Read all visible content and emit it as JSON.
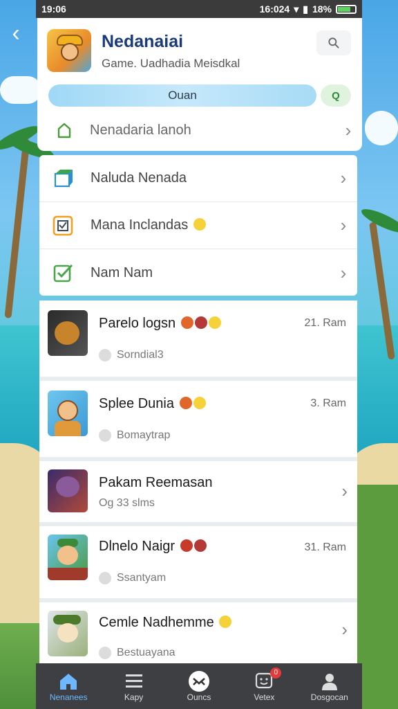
{
  "status_bar": {
    "time": "19:06",
    "right_text": "16:024",
    "battery": "18%"
  },
  "header": {
    "title": "Nedanaiai",
    "subtitle": "Game. Uadhadia Meisdkal",
    "pill_label": "Ouan",
    "pill_go_label": "Q",
    "row_label": "Nenadaria lanoh"
  },
  "menu": [
    {
      "label": "Naluda Nenada",
      "icon": "cube-icon"
    },
    {
      "label": "Mana Inclandas",
      "icon": "checklist-icon"
    },
    {
      "label": "Nam Nam",
      "icon": "check-square-icon"
    }
  ],
  "games": [
    {
      "name": "Parelo logsn",
      "sub": "Sorndial3",
      "time": "21. Ram"
    },
    {
      "name": "Splee Dunia",
      "sub": "Bomaytrap",
      "time": "3. Ram"
    },
    {
      "name": "Pakam Reemasan",
      "sub": "Og 33 slms",
      "time": ""
    },
    {
      "name": "Dlnelo Naigr",
      "sub": "Ssantyam",
      "time": "31. Ram"
    },
    {
      "name": "Cemle Nadhemme",
      "sub": "Bestuayana",
      "time": ""
    }
  ],
  "bottom_nav": [
    {
      "label": "Nenanees",
      "icon": "home-icon"
    },
    {
      "label": "Kapy",
      "icon": "list-icon"
    },
    {
      "label": "Ouncs",
      "icon": "gamepad-icon"
    },
    {
      "label": "Vetex",
      "icon": "chat-icon",
      "badge": "0"
    },
    {
      "label": "Dosgocan",
      "icon": "profile-icon"
    }
  ],
  "colors": {
    "accent": "#6db8ff",
    "title": "#1a3a7a",
    "nav_bg": "#3d3f42"
  }
}
